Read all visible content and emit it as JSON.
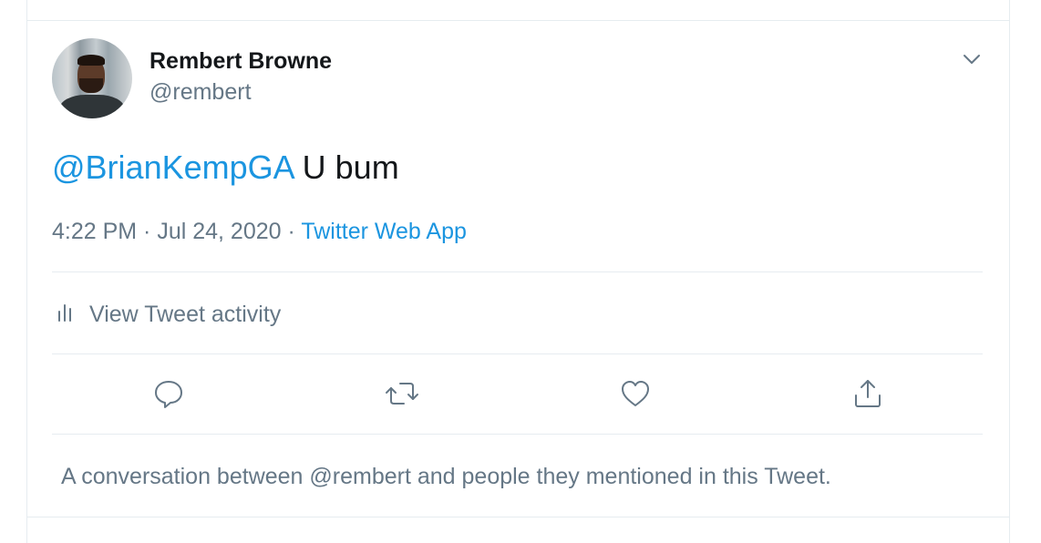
{
  "tweet": {
    "author": {
      "name": "Rembert Browne",
      "handle": "@rembert"
    },
    "text": {
      "mention": "@BrianKempGA",
      "body": " U bum"
    },
    "meta": {
      "time": "4:22 PM",
      "separator1": " · ",
      "date": "Jul 24, 2020",
      "separator2": " · ",
      "source": "Twitter Web App"
    },
    "activity_label": "View Tweet activity",
    "actions": [
      "reply",
      "retweet",
      "like",
      "share"
    ],
    "footer": "A conversation between @rembert and people they mentioned in this Tweet."
  },
  "colors": {
    "link": "#1b95e0",
    "secondary": "#657786",
    "primary": "#14171a",
    "border": "#e6ecf0"
  },
  "icons": [
    "chevron-down-icon",
    "bar-chart-icon",
    "reply-icon",
    "retweet-icon",
    "heart-icon",
    "share-icon"
  ]
}
